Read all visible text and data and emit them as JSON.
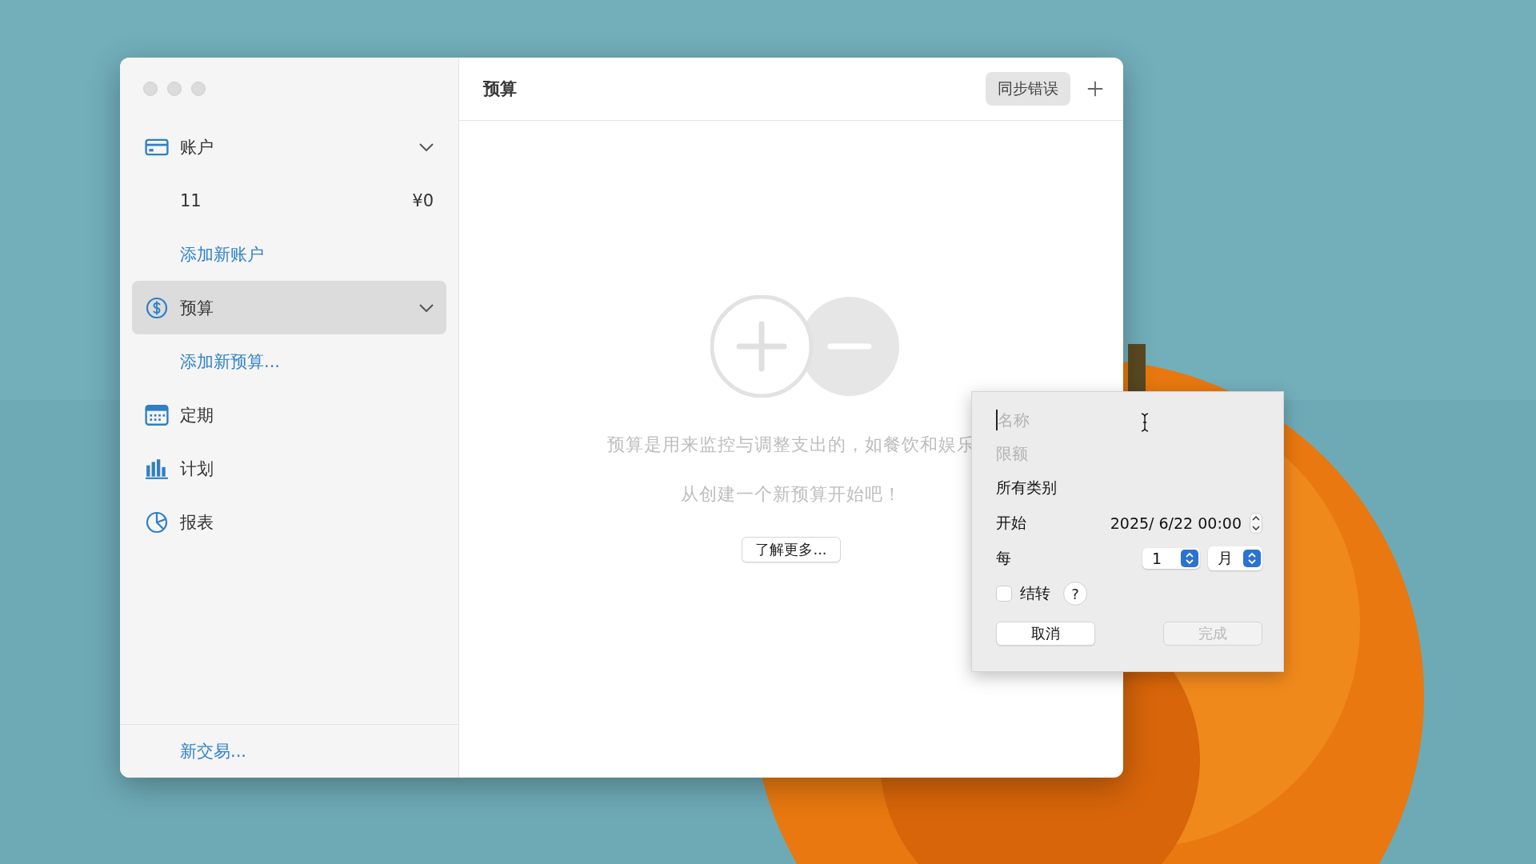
{
  "sidebar": {
    "items": [
      {
        "kind": "header",
        "label": "账户",
        "expanded": true,
        "selected": false
      },
      {
        "kind": "account",
        "name": "11",
        "amount": "¥0"
      },
      {
        "kind": "link",
        "label": "添加新账户"
      },
      {
        "kind": "header",
        "label": "预算",
        "expanded": true,
        "selected": true
      },
      {
        "kind": "link",
        "label": "添加新预算..."
      },
      {
        "kind": "nav",
        "label": "定期",
        "selected": false
      },
      {
        "kind": "nav",
        "label": "计划",
        "selected": false
      },
      {
        "kind": "nav",
        "label": "报表",
        "selected": false
      }
    ],
    "footer_link": "新交易..."
  },
  "main": {
    "title": "预算",
    "sync_button": "同步错误",
    "empty_state": {
      "description": "预算是用来监控与调整支出的，如餐饮和娱乐",
      "prompt": "从创建一个新预算开始吧！",
      "learn_more": "了解更多..."
    }
  },
  "popover": {
    "name_field": {
      "placeholder": "名称"
    },
    "limit_field": {
      "placeholder": "限额"
    },
    "category": "所有类别",
    "start": {
      "label": "开始",
      "value": "2025/  6/22 00:00"
    },
    "every": {
      "label": "每",
      "count": "1",
      "unit": "月"
    },
    "rollover": {
      "label": "结转",
      "checked": false
    },
    "help": "?",
    "cancel": "取消",
    "done": {
      "label": "完成",
      "disabled": true
    }
  }
}
